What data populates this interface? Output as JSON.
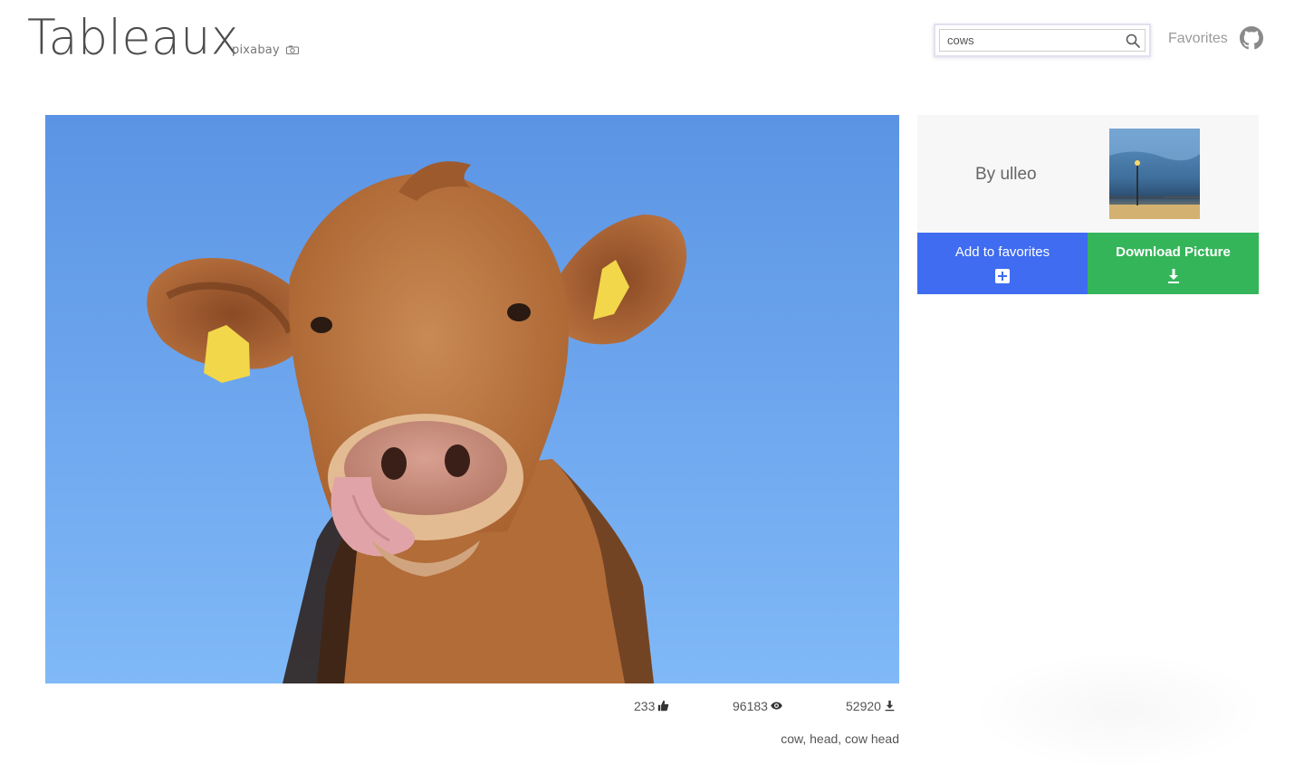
{
  "header": {
    "logo": "Tableaux",
    "brand": "pixabay",
    "search": {
      "value": "cows",
      "placeholder": ""
    },
    "favorites_link": "Favorites"
  },
  "photo": {
    "subject": "cow licking its nose against blue sky",
    "likes": "233",
    "views": "96183",
    "downloads": "52920",
    "tags": "cow, head, cow head"
  },
  "sidebar": {
    "author": "By ulleo",
    "add_to_favorites_label": "Add to favorites",
    "download_label": "Download Picture"
  },
  "colors": {
    "favorites_button": "#3f6cf0",
    "download_button": "#35b55a",
    "sky": "#6aa4ef",
    "cow": "#c07a45"
  },
  "icons": [
    "search-icon",
    "github-icon",
    "thumbs-up-icon",
    "eye-icon",
    "download-icon",
    "plus-square-icon",
    "download-arrow-icon",
    "camera-icon"
  ]
}
